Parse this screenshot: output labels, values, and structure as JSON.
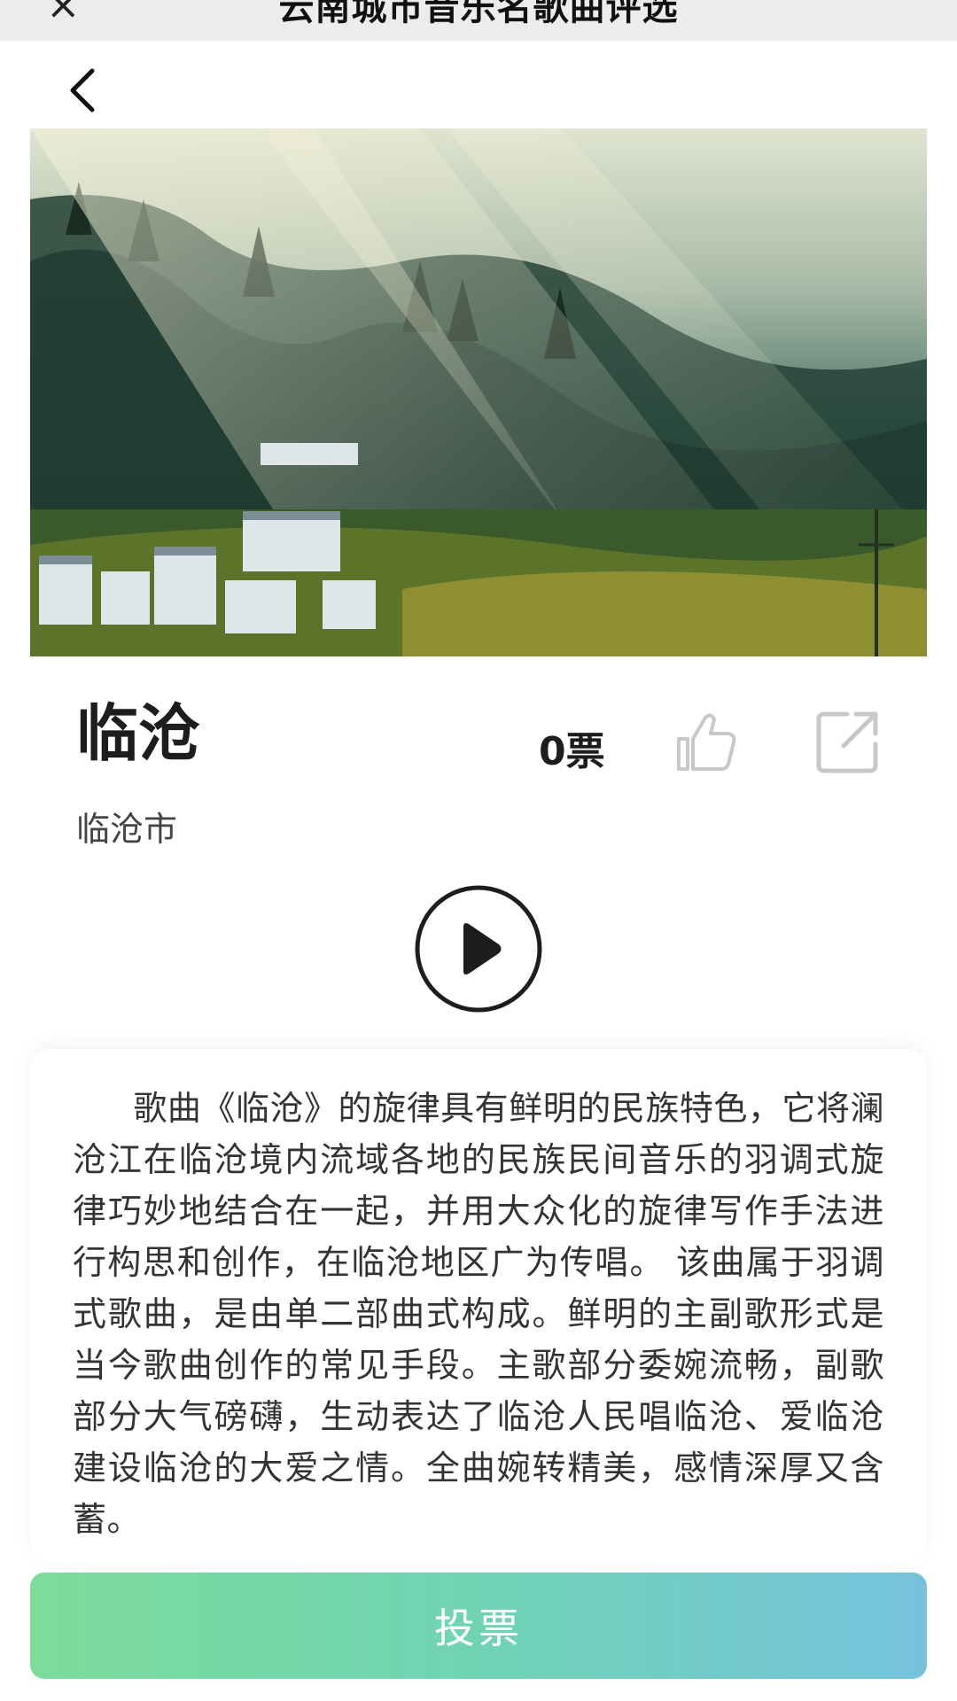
{
  "topbar": {
    "title": "云南城市音乐名歌曲评选",
    "close_glyph": "×"
  },
  "icons": {
    "back": "chevron-left-icon",
    "like": "thumbs-up-icon",
    "share": "share-icon",
    "play": "play-icon",
    "close": "close-icon"
  },
  "song": {
    "title": "临沧",
    "city": "临沧市",
    "votes": "0票"
  },
  "description": "歌曲《临沧》的旋律具有鲜明的民族特色，它将澜沧江在临沧境内流域各地的民族民间音乐的羽调式旋律巧妙地结合在一起，并用大众化的旋律写作手法进行构思和创作，在临沧地区广为传唱。 该曲属于羽调式歌曲，是由单二部曲式构成。鲜明的主副歌形式是当今歌曲创作的常见手段。主歌部分委婉流畅，副歌部分大气磅礴，生动表达了临沧人民唱临沧、爱临沧建设临沧的大爱之情。全曲婉转精美，感情深厚又含蓄。",
  "actions": {
    "vote_label": "投票"
  },
  "colors": {
    "vote_gradient_start": "#7ddc9a",
    "vote_gradient_end": "#76c2dd",
    "icon_gray": "#c8c8c8"
  }
}
